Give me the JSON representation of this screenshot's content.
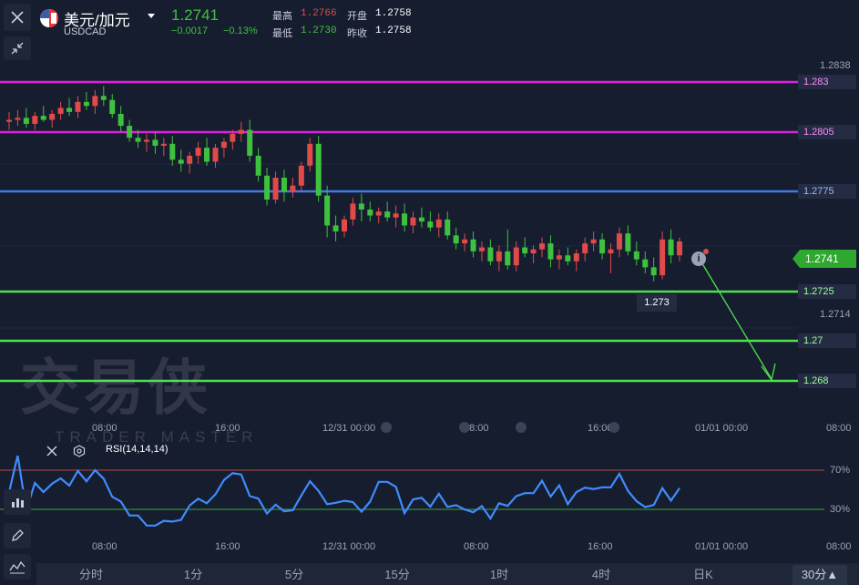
{
  "header": {
    "pair_name": "美元/加元",
    "symbol": "USDCAD",
    "last_price": "1.2741",
    "change": "−0.0017",
    "change_pct": "−0.13%",
    "high_label": "最高",
    "high_value": "1.2766",
    "low_label": "最低",
    "low_value": "1.2730",
    "open_label": "开盘",
    "open_value": "1.2758",
    "prev_close_label": "昨收",
    "prev_close_value": "1.2758"
  },
  "price_axis": {
    "top_value": "1.2838",
    "mid_value": "1.2714",
    "current_price": "1.2741"
  },
  "levels": [
    {
      "label": "1.283",
      "color": "#e020e0"
    },
    {
      "label": "1.2805",
      "color": "#e020e0"
    },
    {
      "label": "1.2775",
      "color": "#3f78e8"
    },
    {
      "label": "1.2725",
      "color": "#4ee04e"
    },
    {
      "label": "1.27",
      "color": "#4ee04e"
    },
    {
      "label": "1.268",
      "color": "#4ee04e"
    }
  ],
  "annotation_low": "1.273",
  "time_axis": [
    "08:00",
    "16:00",
    "12/31  00:00",
    "08:00",
    "16:00",
    "01/01  00:00",
    "08:00"
  ],
  "rsi": {
    "title": "RSI(14,14,14)",
    "upper_label": "70%",
    "lower_label": "30%"
  },
  "watermark": {
    "main": "交易侠",
    "sub": "TRADER MASTER"
  },
  "tabs": [
    "分时",
    "1分",
    "5分",
    "15分",
    "1时",
    "4时",
    "日K",
    "30分▲"
  ],
  "colors": {
    "bg": "#161d2e",
    "up": "#e04a4a",
    "down": "#3ec23e",
    "magenta": "#e020e0",
    "blue": "#3f78e8",
    "green": "#4ee04e"
  },
  "chart_data": {
    "type": "candlestick",
    "symbol": "USDCAD",
    "ylim": [
      1.266,
      1.2845
    ],
    "candles": [
      [
        1.281,
        1.2815,
        1.2806,
        1.2811
      ],
      [
        1.2811,
        1.2816,
        1.2808,
        1.2812
      ],
      [
        1.2812,
        1.2817,
        1.2807,
        1.2809
      ],
      [
        1.2809,
        1.2815,
        1.2806,
        1.2813
      ],
      [
        1.2813,
        1.2818,
        1.281,
        1.2811
      ],
      [
        1.2811,
        1.2816,
        1.2807,
        1.2814
      ],
      [
        1.2814,
        1.282,
        1.2811,
        1.2817
      ],
      [
        1.2817,
        1.2822,
        1.2813,
        1.2815
      ],
      [
        1.2815,
        1.2823,
        1.2812,
        1.282
      ],
      [
        1.282,
        1.2825,
        1.2816,
        1.2818
      ],
      [
        1.2818,
        1.2826,
        1.2814,
        1.2823
      ],
      [
        1.2823,
        1.2828,
        1.2818,
        1.2821
      ],
      [
        1.2821,
        1.2824,
        1.2812,
        1.2814
      ],
      [
        1.2814,
        1.2818,
        1.2805,
        1.2808
      ],
      [
        1.2808,
        1.2811,
        1.28,
        1.2802
      ],
      [
        1.2802,
        1.2806,
        1.2797,
        1.28
      ],
      [
        1.28,
        1.2804,
        1.2795,
        1.2801
      ],
      [
        1.2801,
        1.2805,
        1.2794,
        1.2798
      ],
      [
        1.2798,
        1.2802,
        1.2793,
        1.2799
      ],
      [
        1.2799,
        1.2803,
        1.2788,
        1.2791
      ],
      [
        1.2791,
        1.2796,
        1.2785,
        1.2789
      ],
      [
        1.2789,
        1.2795,
        1.2784,
        1.2793
      ],
      [
        1.2793,
        1.28,
        1.2789,
        1.2797
      ],
      [
        1.2797,
        1.2802,
        1.2788,
        1.279
      ],
      [
        1.279,
        1.2799,
        1.2787,
        1.2797
      ],
      [
        1.2797,
        1.2802,
        1.2792,
        1.28
      ],
      [
        1.28,
        1.2806,
        1.2796,
        1.2804
      ],
      [
        1.2804,
        1.281,
        1.28,
        1.2806
      ],
      [
        1.2806,
        1.2811,
        1.279,
        1.2793
      ],
      [
        1.2793,
        1.2797,
        1.278,
        1.2783
      ],
      [
        1.2783,
        1.2787,
        1.2768,
        1.2771
      ],
      [
        1.2771,
        1.2785,
        1.2769,
        1.2782
      ],
      [
        1.2782,
        1.2786,
        1.277,
        1.2775
      ],
      [
        1.2775,
        1.2782,
        1.2772,
        1.2778
      ],
      [
        1.2778,
        1.279,
        1.2775,
        1.2788
      ],
      [
        1.2788,
        1.2802,
        1.2785,
        1.2799
      ],
      [
        1.2799,
        1.2803,
        1.277,
        1.2773
      ],
      [
        1.2773,
        1.2778,
        1.2752,
        1.2758
      ],
      [
        1.2758,
        1.2763,
        1.275,
        1.2755
      ],
      [
        1.2755,
        1.2763,
        1.2752,
        1.2761
      ],
      [
        1.2761,
        1.2772,
        1.2758,
        1.2769
      ],
      [
        1.2769,
        1.2774,
        1.276,
        1.2766
      ],
      [
        1.2766,
        1.277,
        1.276,
        1.2763
      ],
      [
        1.2763,
        1.2767,
        1.2759,
        1.2765
      ],
      [
        1.2765,
        1.277,
        1.276,
        1.2762
      ],
      [
        1.2762,
        1.2768,
        1.2757,
        1.2764
      ],
      [
        1.2764,
        1.2769,
        1.2755,
        1.2758
      ],
      [
        1.2758,
        1.2765,
        1.2754,
        1.2762
      ],
      [
        1.2762,
        1.2767,
        1.2757,
        1.276
      ],
      [
        1.276,
        1.2765,
        1.2755,
        1.2757
      ],
      [
        1.2757,
        1.2764,
        1.2752,
        1.2761
      ],
      [
        1.2761,
        1.2765,
        1.2751,
        1.2753
      ],
      [
        1.2753,
        1.2757,
        1.2746,
        1.2749
      ],
      [
        1.2749,
        1.2754,
        1.2745,
        1.2751
      ],
      [
        1.2751,
        1.2755,
        1.2742,
        1.2745
      ],
      [
        1.2745,
        1.275,
        1.274,
        1.2747
      ],
      [
        1.2747,
        1.2751,
        1.2738,
        1.274
      ],
      [
        1.274,
        1.2748,
        1.2735,
        1.2745
      ],
      [
        1.2745,
        1.2756,
        1.2736,
        1.2738
      ],
      [
        1.2738,
        1.275,
        1.2735,
        1.2747
      ],
      [
        1.2747,
        1.2752,
        1.2742,
        1.2744
      ],
      [
        1.2744,
        1.2748,
        1.2739,
        1.2746
      ],
      [
        1.2746,
        1.2752,
        1.2742,
        1.2749
      ],
      [
        1.2749,
        1.2753,
        1.2737,
        1.2741
      ],
      [
        1.2741,
        1.2746,
        1.2736,
        1.2743
      ],
      [
        1.2743,
        1.2747,
        1.2738,
        1.274
      ],
      [
        1.274,
        1.2746,
        1.2735,
        1.2744
      ],
      [
        1.2744,
        1.2752,
        1.274,
        1.2749
      ],
      [
        1.2749,
        1.2755,
        1.2745,
        1.2751
      ],
      [
        1.2751,
        1.2754,
        1.2741,
        1.2744
      ],
      [
        1.2744,
        1.2749,
        1.2734,
        1.2746
      ],
      [
        1.2746,
        1.2757,
        1.2742,
        1.2754
      ],
      [
        1.2754,
        1.2758,
        1.2743,
        1.2745
      ],
      [
        1.2745,
        1.275,
        1.2738,
        1.2741
      ],
      [
        1.2741,
        1.2745,
        1.2734,
        1.2737
      ],
      [
        1.2737,
        1.2742,
        1.273,
        1.2733
      ],
      [
        1.2733,
        1.2755,
        1.2731,
        1.2751
      ],
      [
        1.2751,
        1.2756,
        1.2739,
        1.2743
      ],
      [
        1.2743,
        1.2752,
        1.274,
        1.275
      ]
    ]
  }
}
